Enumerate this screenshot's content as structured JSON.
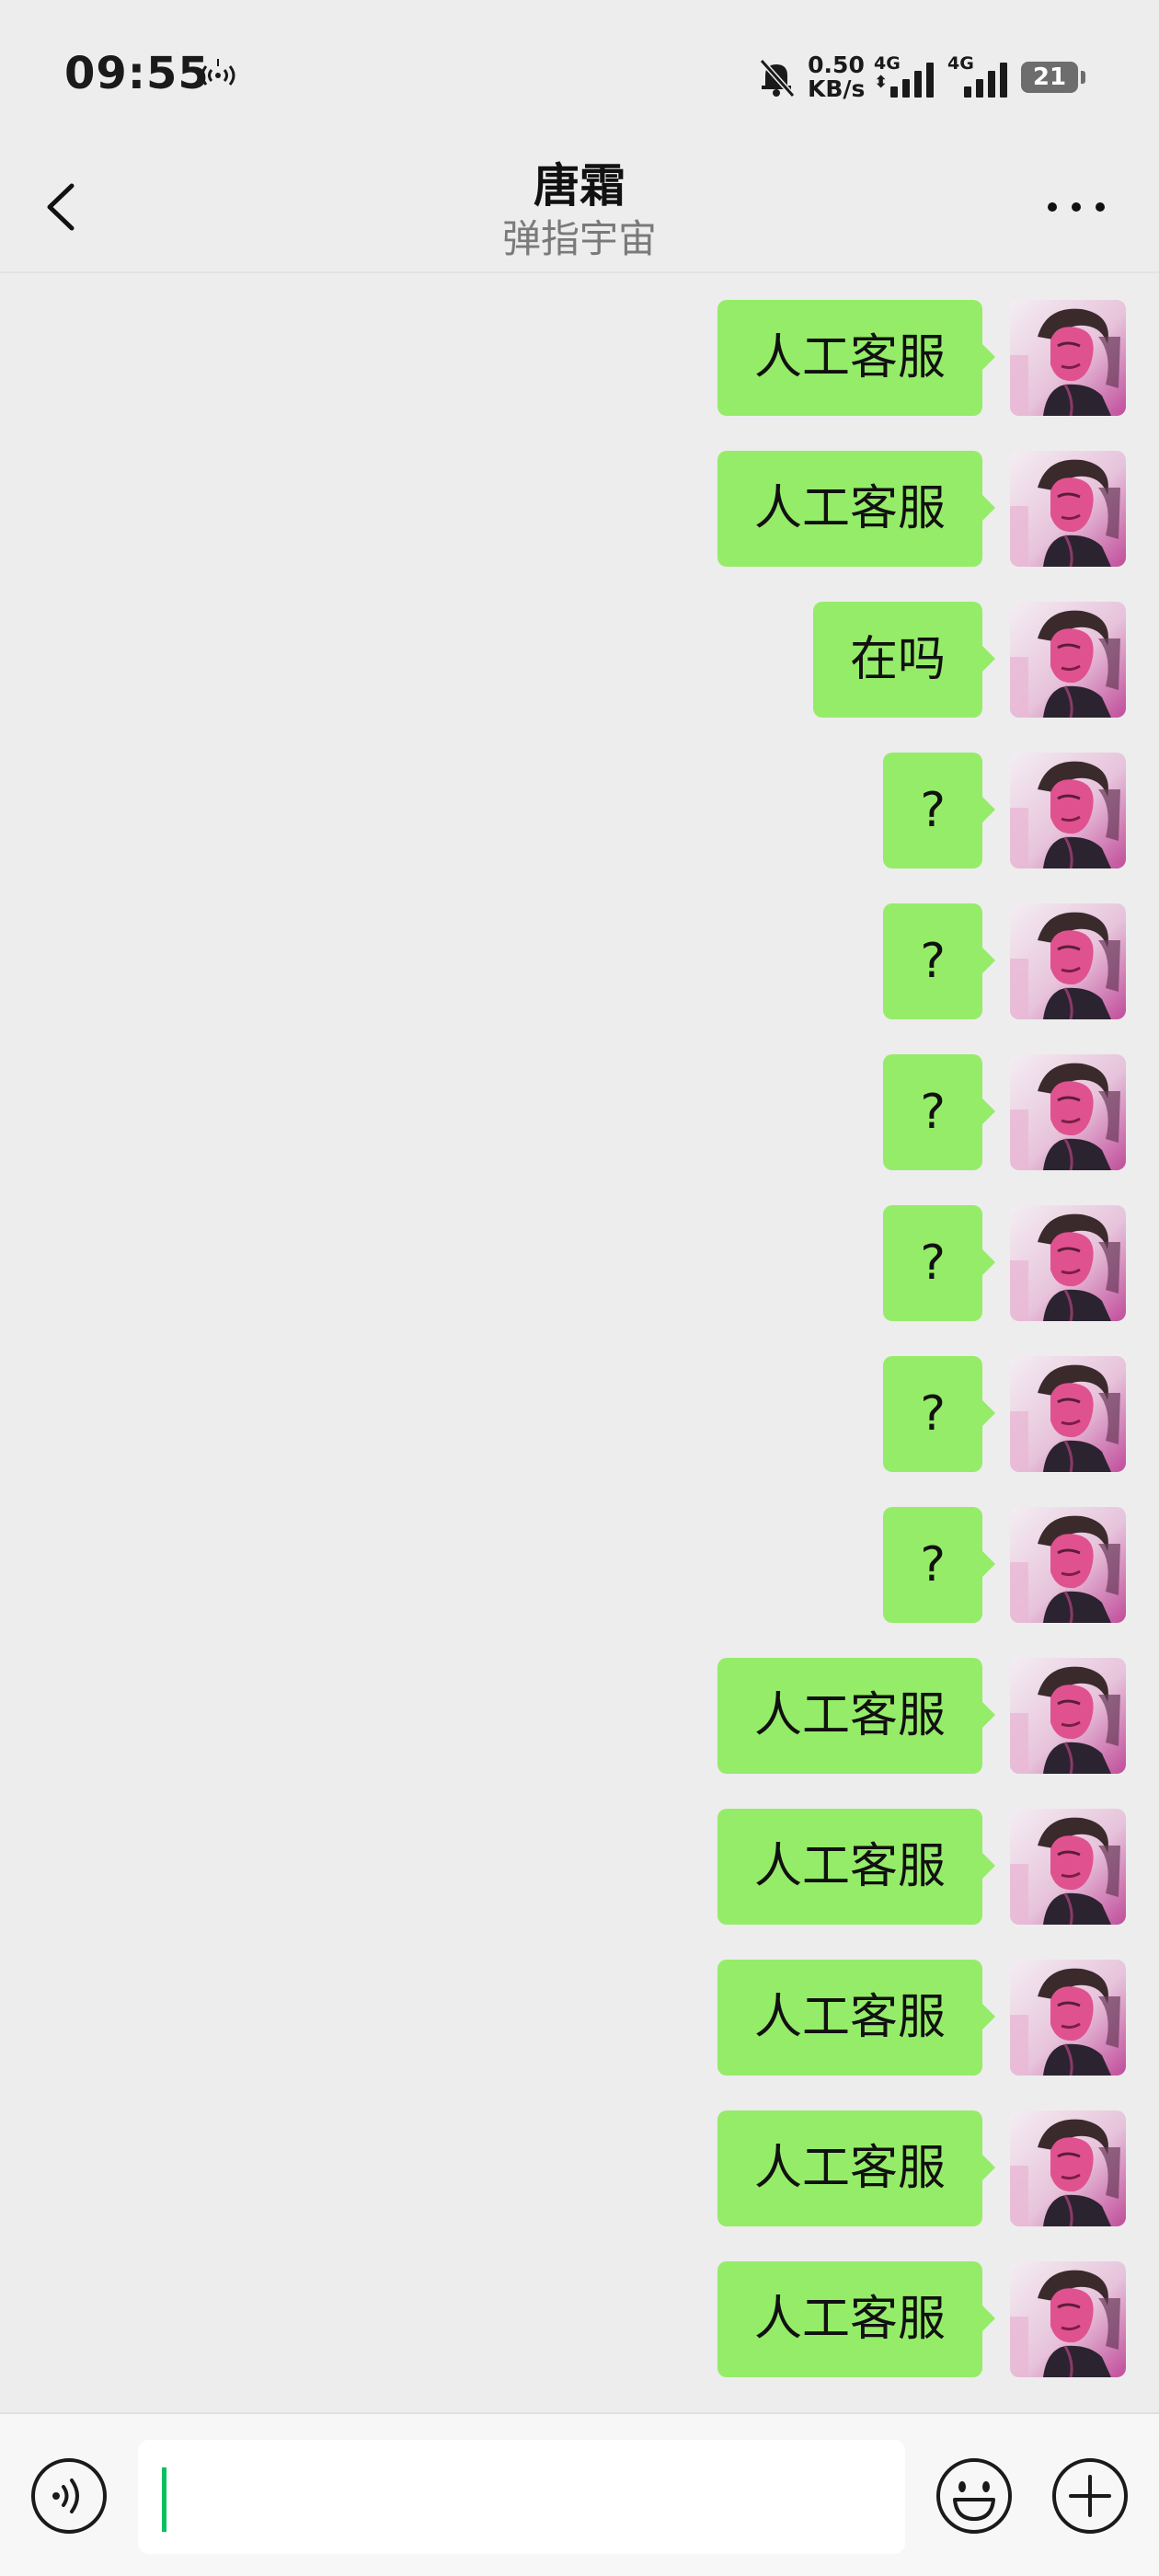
{
  "status_bar": {
    "time": "09:55",
    "net_speed_value": "0.50",
    "net_speed_unit": "KB/s",
    "signal_1_tag": "4G",
    "signal_2_tag": "4G",
    "battery": "21",
    "icons": [
      "hotspot-icon",
      "mute-icon",
      "signal-icon",
      "battery-icon"
    ]
  },
  "header": {
    "title": "唐霜",
    "subtitle": "弹指宇宙",
    "icons": [
      "back-icon",
      "more-icon"
    ]
  },
  "messages": [
    {
      "text": "人工客服"
    },
    {
      "text": "人工客服"
    },
    {
      "text": "在吗"
    },
    {
      "text": "?"
    },
    {
      "text": "?"
    },
    {
      "text": "?"
    },
    {
      "text": "?"
    },
    {
      "text": "?"
    },
    {
      "text": "?"
    },
    {
      "text": "人工客服"
    },
    {
      "text": "人工客服"
    },
    {
      "text": "人工客服"
    },
    {
      "text": "人工客服"
    },
    {
      "text": "人工客服"
    }
  ],
  "input_bar": {
    "input_value": "",
    "icons": [
      "voice-icon",
      "emoji-icon",
      "plus-icon"
    ]
  },
  "colors": {
    "background": "#ededed",
    "bubble": "#95ec69",
    "caret": "#07c160",
    "subtitle": "#7a7a7a"
  }
}
